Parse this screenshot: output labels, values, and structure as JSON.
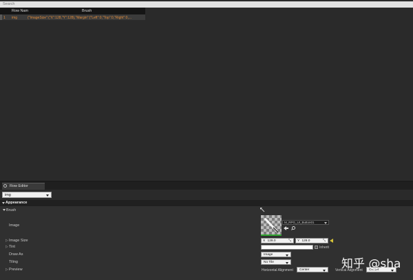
{
  "search": {
    "placeholder": "Search"
  },
  "table": {
    "headers": [
      "Row Nam",
      "Brush"
    ],
    "rows": [
      {
        "index": "1",
        "name": "img",
        "brush": "(\"ImageSize\":(\"X\":128,\"Y\":128),\"Margin\":(\"Left\":0,\"Top\":0,\"Right\":0,..."
      }
    ]
  },
  "row_editor": {
    "tab_label": "Row Editor",
    "selected_row": "img",
    "section_title": "Appearance",
    "category": "Brush",
    "properties": {
      "image": "Image",
      "image_size": "Image Size",
      "tint": "Tint",
      "draw_as": "Draw As",
      "tiling": "Tiling",
      "preview": "Preview"
    },
    "image_asset": "M_RPG_UI_Button01",
    "size_x_label": "X",
    "size_x": "128.0",
    "size_y_label": "Y",
    "size_y": "128.0",
    "inherit_label": "Inherit",
    "draw_as_value": "Image",
    "tiling_value": "No Tile",
    "h_align_label": "Horizontal Alignment",
    "h_align_value": "Center",
    "v_align_label": "Vertical Alignment",
    "v_align_value": "Center"
  },
  "watermark": "知乎 @sha",
  "colors": {
    "tint": "#ffffff",
    "accent_orange": "#e08c3c",
    "thumb_underline": "#2fa52f",
    "inherit_arrow": "#d4c238"
  }
}
